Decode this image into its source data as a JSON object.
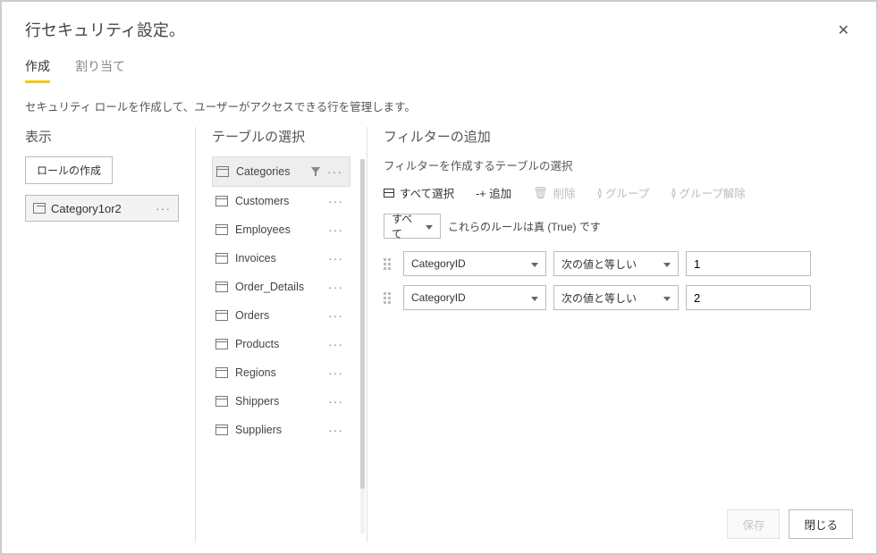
{
  "header": {
    "title": "行セキュリティ設定。"
  },
  "tabs": {
    "create": "作成",
    "assign": "割り当て",
    "active": "create"
  },
  "subtitle": "セキュリティ ロールを作成して、ユーザーがアクセスできる行を管理します。",
  "roles": {
    "heading": "表示",
    "create_label": "ロールの作成",
    "items": [
      {
        "name": "Category1or2"
      }
    ]
  },
  "tables": {
    "heading": "テーブルの選択",
    "items": [
      {
        "name": "Categories",
        "selected": true,
        "has_filter": true
      },
      {
        "name": "Customers"
      },
      {
        "name": "Employees"
      },
      {
        "name": "Invoices"
      },
      {
        "name": "Order_Details"
      },
      {
        "name": "Orders"
      },
      {
        "name": "Products"
      },
      {
        "name": "Regions"
      },
      {
        "name": "Shippers"
      },
      {
        "name": "Suppliers"
      }
    ]
  },
  "filter": {
    "heading": "フィルターの追加",
    "subheading": "フィルターを作成するテーブルの選択",
    "toolbar": {
      "select_all": "すべて選択",
      "add": "-+ 追加",
      "delete": "削除",
      "group": "グループ",
      "ungroup": "グループ解除"
    },
    "logic": {
      "selector": "すべて",
      "text": "これらのルールは真 (True) です"
    },
    "rules": [
      {
        "field": "CategoryID",
        "op": "次の値と等しい",
        "value": "1"
      },
      {
        "field": "CategoryID",
        "op": "次の値と等しい",
        "value": "2"
      }
    ]
  },
  "footer": {
    "save": "保存",
    "close": "閉じる"
  }
}
